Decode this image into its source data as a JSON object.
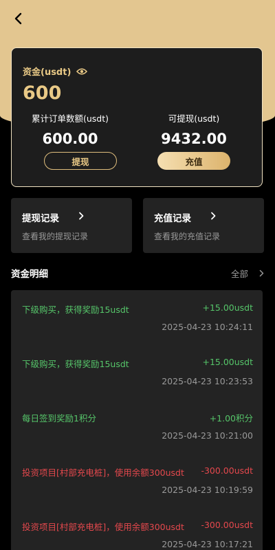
{
  "colors": {
    "accent": "#e9c986",
    "header_bg": "#e3c690",
    "positive": "#56c66a",
    "negative": "#e5484d"
  },
  "header": {
    "back_icon": "chevron-left-icon"
  },
  "card": {
    "asset_label": "资金(usdt)",
    "eye_icon": "eye-icon",
    "asset_value": "600",
    "cumulative_label": "累计订单数额(usdt)",
    "cumulative_value": "600.00",
    "withdrawable_label": "可提现(usdt)",
    "withdrawable_value": "9432.00",
    "withdraw_button": "提现",
    "recharge_button": "充值"
  },
  "records": [
    {
      "title": "提现记录",
      "subtitle": "查看我的提现记录"
    },
    {
      "title": "充值记录",
      "subtitle": "查看我的充值记录"
    }
  ],
  "details": {
    "title": "资金明细",
    "filter_label": "全部",
    "items": [
      {
        "desc": "下级购买，获得奖励15usdt",
        "amount": "+15.00usdt",
        "time": "2025-04-23 10:24:11",
        "type": "positive"
      },
      {
        "desc": "下级购买，获得奖励15usdt",
        "amount": "+15.00usdt",
        "time": "2025-04-23 10:23:53",
        "type": "positive"
      },
      {
        "desc": "每日签到奖励1积分",
        "amount": "+1.00积分",
        "time": "2025-04-23 10:21:00",
        "type": "positive"
      },
      {
        "desc": "投资项目[村部充电桩]，使用余额300usdt",
        "amount": "-300.00usdt",
        "time": "2025-04-23 10:19:59",
        "type": "negative"
      },
      {
        "desc": "投资项目[村部充电桩]，使用余额300usdt",
        "amount": "-300.00usdt",
        "time": "2025-04-23 10:17:21",
        "type": "negative"
      }
    ]
  }
}
